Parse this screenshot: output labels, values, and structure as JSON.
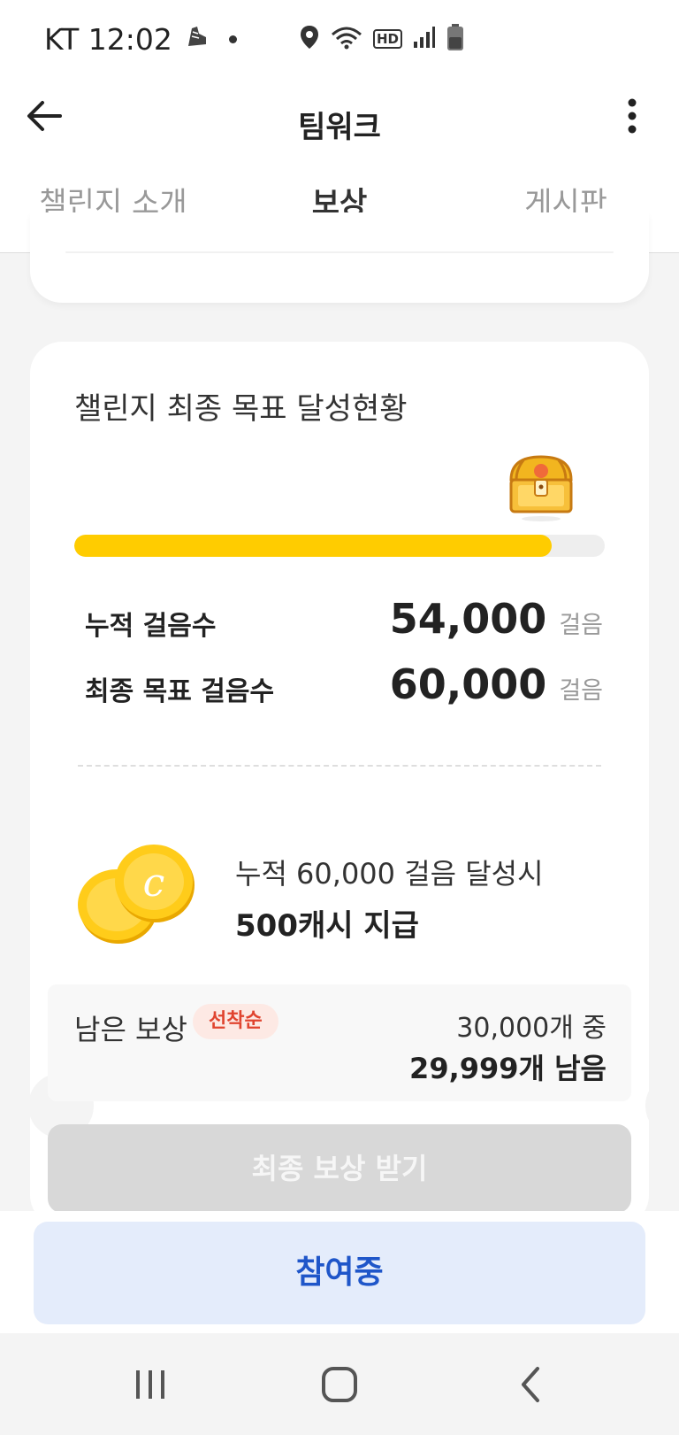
{
  "status_bar": {
    "carrier_time": "KT 12:02",
    "network_badge": "HD",
    "icons": [
      "shoe-icon",
      "dot-icon",
      "location-icon",
      "wifi-icon",
      "signal-icon",
      "battery-icon"
    ]
  },
  "app_bar": {
    "title": "팀워크",
    "back_icon": "arrow-left-icon",
    "more_icon": "more-vertical-icon"
  },
  "tabs": [
    {
      "label": "챌린지 소개",
      "selected": false
    },
    {
      "label": "보상",
      "selected": true
    },
    {
      "label": "게시판",
      "selected": false
    }
  ],
  "goal_card": {
    "title": "챌린지 최종 목표 달성현황",
    "progress": 0.9,
    "stats": [
      {
        "label": "누적 걸음수",
        "value": "54,000",
        "unit": "걸음"
      },
      {
        "label": "최종 목표 걸음수",
        "value": "60,000",
        "unit": "걸음"
      }
    ],
    "reward": {
      "condition": "누적 60,000 걸음 달성시",
      "amount": "500캐시 지급"
    },
    "remaining": {
      "label": "남은 보상",
      "badge": "선착순",
      "total": "30,000개 중",
      "left": "29,999개 남음"
    },
    "claim_button": "최종 보상 받기"
  },
  "bottom": {
    "join_button": "참여중"
  },
  "colors": {
    "accent_yellow": "#ffcc00",
    "join_blue": "#1f56c9",
    "badge_red": "#e0442f"
  }
}
